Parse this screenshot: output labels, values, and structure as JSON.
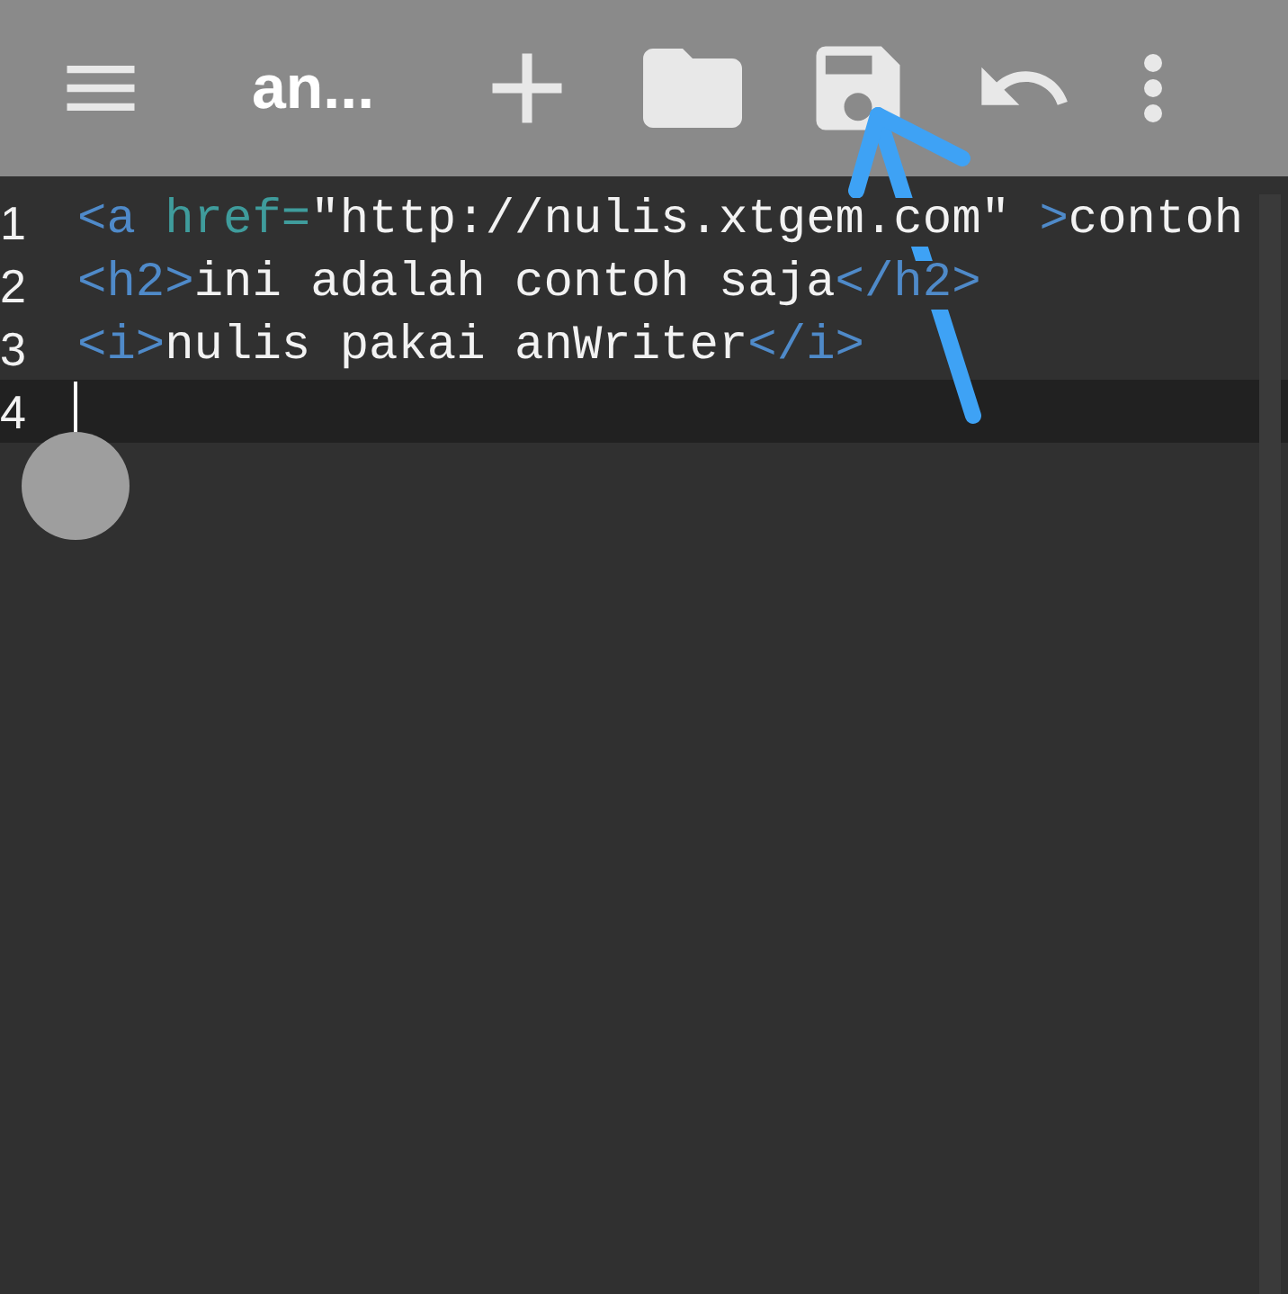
{
  "toolbar": {
    "title": "an..."
  },
  "editor": {
    "lines": [
      {
        "number": "1",
        "current": false,
        "tokens": [
          {
            "kind": "tag",
            "text": "<a "
          },
          {
            "kind": "attr",
            "text": "href="
          },
          {
            "kind": "string",
            "text": "\"http://nulis.xtgem.com\""
          },
          {
            "kind": "tag",
            "text": " >"
          },
          {
            "kind": "text",
            "text": "contoh"
          }
        ]
      },
      {
        "number": "2",
        "current": false,
        "tokens": [
          {
            "kind": "tag",
            "text": "<h2>"
          },
          {
            "kind": "text",
            "text": "ini adalah contoh saja"
          },
          {
            "kind": "tag",
            "text": "</h2>"
          }
        ]
      },
      {
        "number": "3",
        "current": false,
        "tokens": [
          {
            "kind": "tag",
            "text": "<i>"
          },
          {
            "kind": "text",
            "text": "nulis pakai anWriter"
          },
          {
            "kind": "tag",
            "text": "</i>"
          }
        ]
      },
      {
        "number": "4",
        "current": true
      }
    ]
  }
}
